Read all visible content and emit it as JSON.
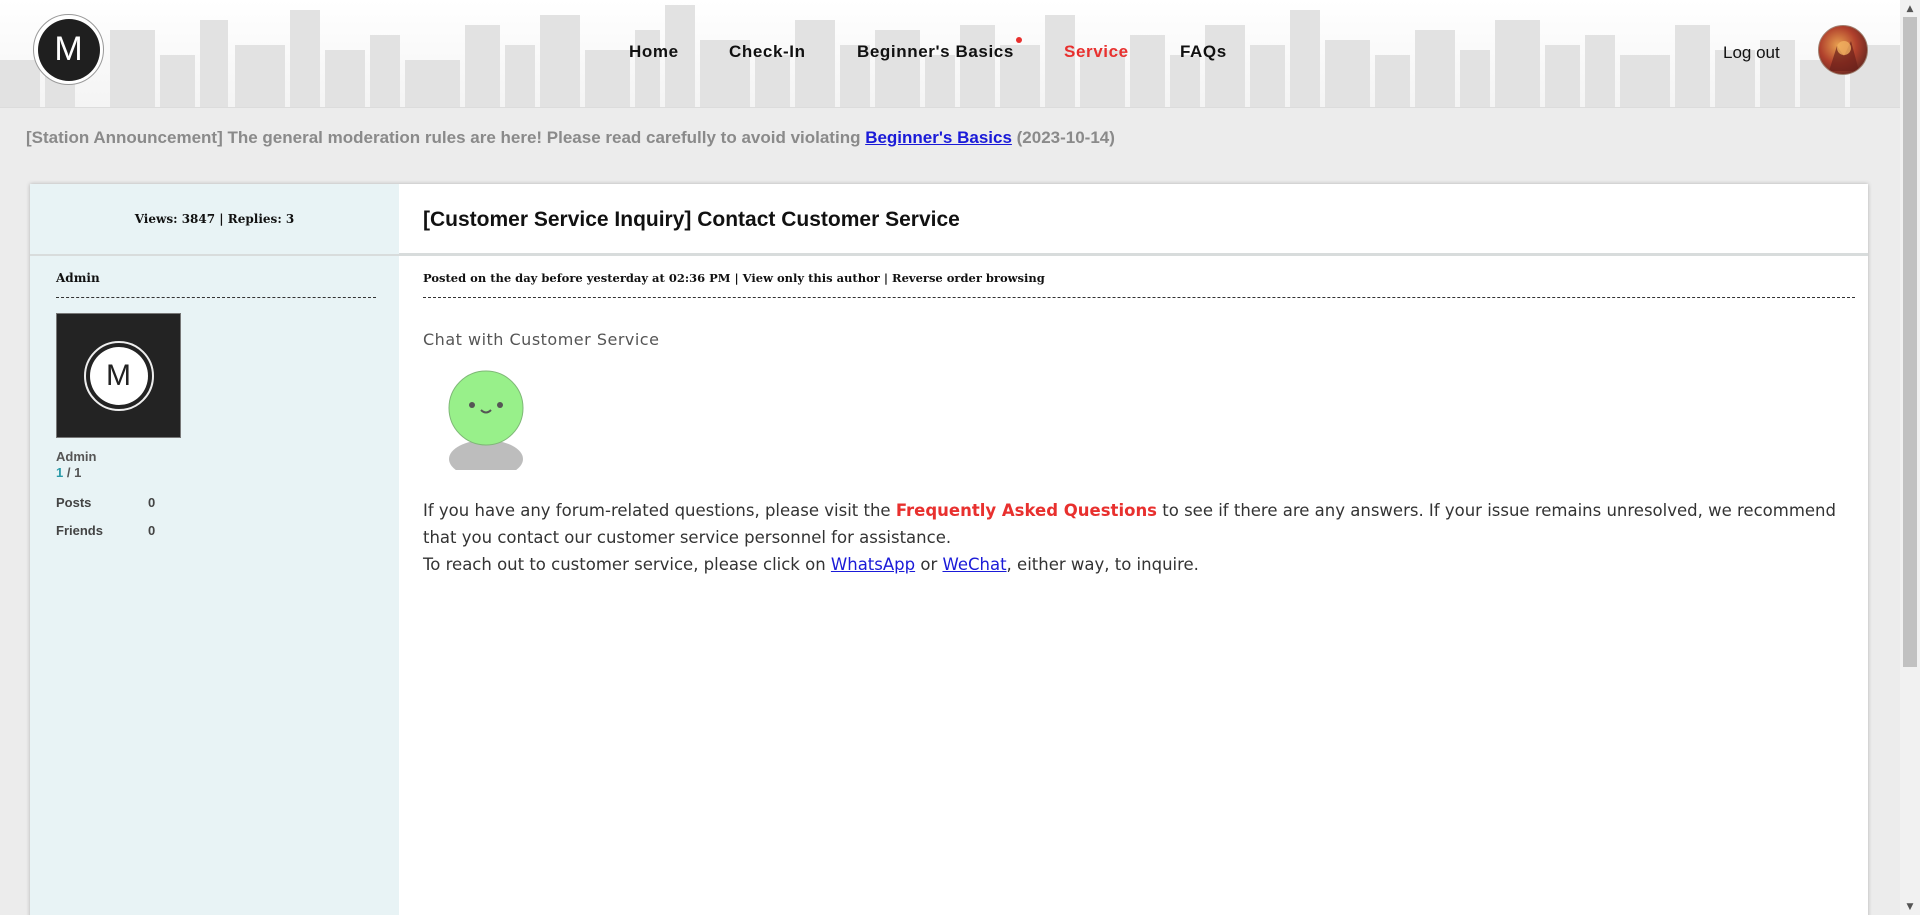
{
  "header": {
    "logo_letter": "M",
    "nav": [
      {
        "label": "Home"
      },
      {
        "label": "Check-In"
      },
      {
        "label": "Beginner's Basics"
      },
      {
        "label": "Service"
      },
      {
        "label": "FAQs"
      }
    ],
    "active_nav": "Service",
    "logout_label": "Log out"
  },
  "announcement": {
    "prefix": "[Station Announcement] The general moderation rules are here! Please read carefully to avoid violating ",
    "link": "Beginner's Basics",
    "date": " (2023-10-14)"
  },
  "post": {
    "stats": "Views: 3847 | Replies: 3",
    "title": "[Customer Service Inquiry] Contact Customer Service",
    "meta": {
      "posted": "Posted on the day before yesterday at 02:36 PM",
      "sep1": " | ",
      "view_author": "View only this author",
      "sep2": " | ",
      "reverse": "Reverse order browsing"
    },
    "author": {
      "head": "Admin",
      "avatar_letter": "M",
      "name": "Admin",
      "level_current": "1",
      "level_sep": " / ",
      "level_total": "1",
      "posts_label": "Posts",
      "posts_value": "0",
      "friends_label": "Friends",
      "friends_value": "0"
    },
    "chat_label": "Chat with Customer Service",
    "body": {
      "p1_a": "If you have any forum-related questions, please visit the ",
      "p1_faq": "Frequently Asked Questions",
      "p1_b": " to see if there are any answers. If your issue remains unresolved, we recommend that you contact our customer service personnel for assistance.",
      "p2_a": "To reach out to customer service, please click on ",
      "p2_whatsapp": "WhatsApp",
      "p2_or": " or ",
      "p2_wechat": "WeChat",
      "p2_b": ", either way, to inquire."
    }
  },
  "colors": {
    "accent_red": "#e8302e",
    "link_blue": "#1a1ad8",
    "sidebar_bg": "#e8f3f5",
    "mascot_green": "#98f08a"
  }
}
